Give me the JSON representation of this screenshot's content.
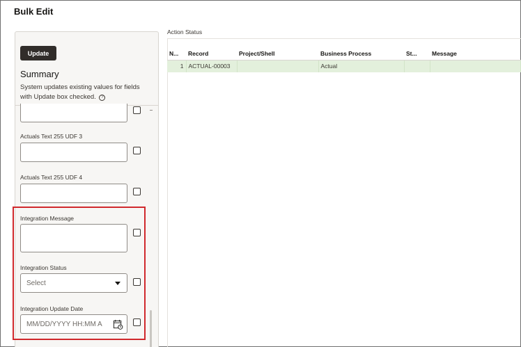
{
  "window": {
    "title": "Bulk Edit"
  },
  "left_panel": {
    "update_label": "Update",
    "summary_title": "Summary",
    "summary_desc": "System updates existing values for fields with Update box checked.",
    "help_icon": "question-circle-icon",
    "fields": {
      "udf3_label": "Actuals Text 255 UDF 3",
      "udf4_label": "Actuals Text 255 UDF 4",
      "integration_message_label": "Integration Message",
      "integration_status_label": "Integration Status",
      "integration_status_value": "Select",
      "integration_update_date_label": "Integration Update Date",
      "integration_update_date_placeholder": "MM/DD/YYYY HH:MM A"
    }
  },
  "action_status": {
    "label": "Action Status",
    "columns": [
      "N...",
      "Record",
      "Project/Shell",
      "Business Process",
      "St...",
      "Message"
    ],
    "rows": [
      {
        "no": "1",
        "record": "ACTUAL-00003",
        "project": "",
        "business_process": "Actual",
        "status": "",
        "message": ""
      }
    ]
  },
  "colors": {
    "highlight": "#d0282c",
    "row_success": "#e3f0dc",
    "button": "#312d2a"
  }
}
